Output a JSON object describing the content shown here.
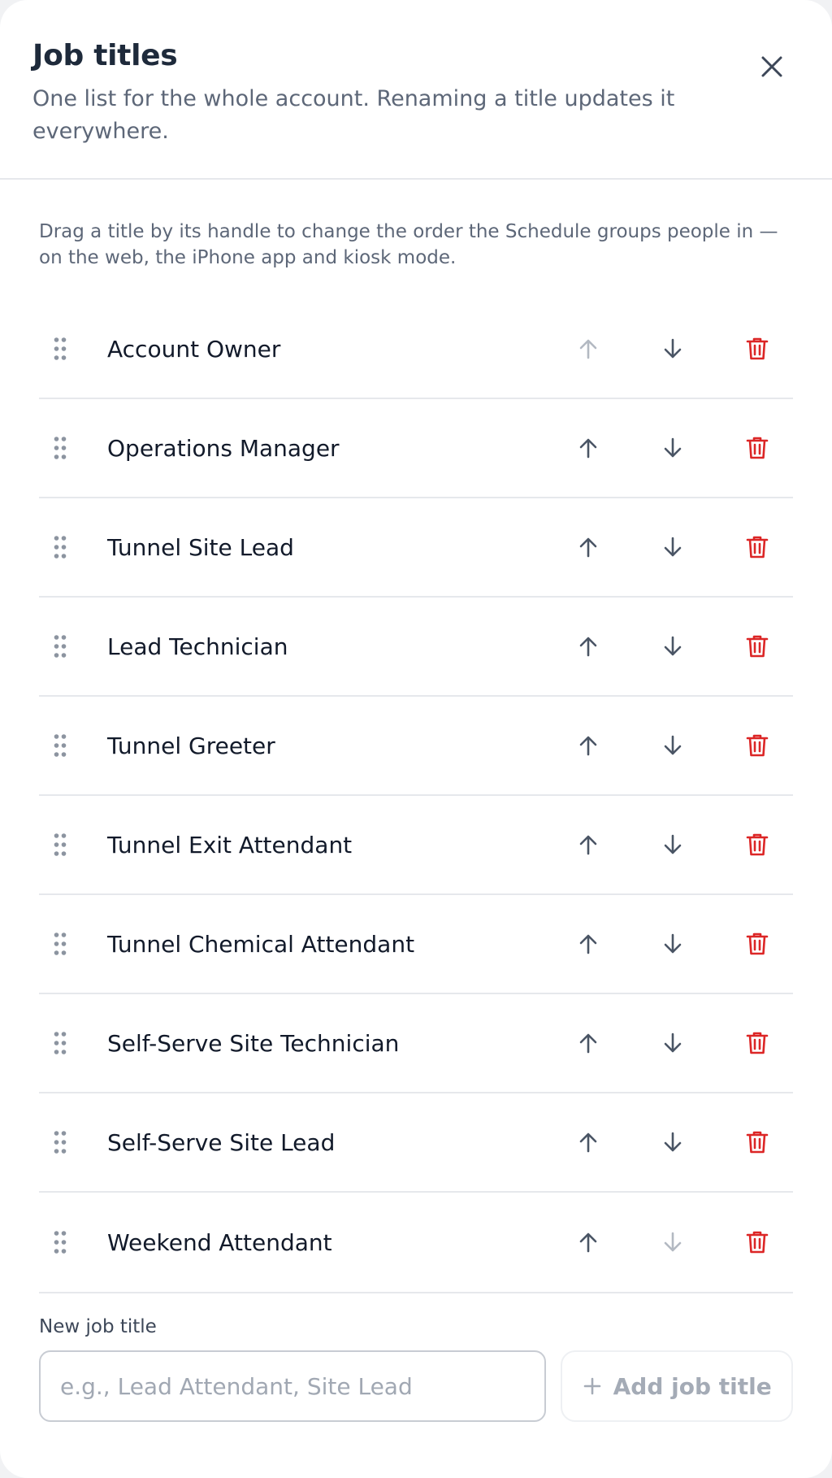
{
  "header": {
    "title": "Job titles",
    "subtitle": "One list for the whole account. Renaming a title updates it everywhere.",
    "close_icon": "close-icon"
  },
  "hint": "Drag a title by its handle to change the order the Schedule groups people in — on the web, the iPhone app and kiosk mode.",
  "job_titles": [
    {
      "label": "Account Owner",
      "up_disabled": true,
      "down_disabled": false
    },
    {
      "label": "Operations Manager",
      "up_disabled": false,
      "down_disabled": false
    },
    {
      "label": "Tunnel Site Lead",
      "up_disabled": false,
      "down_disabled": false
    },
    {
      "label": "Lead Technician",
      "up_disabled": false,
      "down_disabled": false
    },
    {
      "label": "Tunnel Greeter",
      "up_disabled": false,
      "down_disabled": false
    },
    {
      "label": "Tunnel Exit Attendant",
      "up_disabled": false,
      "down_disabled": false
    },
    {
      "label": "Tunnel Chemical Attendant",
      "up_disabled": false,
      "down_disabled": false
    },
    {
      "label": "Self-Serve Site Technician",
      "up_disabled": false,
      "down_disabled": false
    },
    {
      "label": "Self-Serve Site Lead",
      "up_disabled": false,
      "down_disabled": false
    },
    {
      "label": "Weekend Attendant",
      "up_disabled": false,
      "down_disabled": true
    }
  ],
  "new_title": {
    "label": "New job title",
    "value": "",
    "placeholder": "e.g., Lead Attendant, Site Lead",
    "add_button_label": "Add job title",
    "add_button_disabled": true
  },
  "colors": {
    "title": "#1e2a3b",
    "muted_text": "#5d6778",
    "icon": "#4a5565",
    "icon_disabled": "#b3b9c2",
    "danger": "#dc2626",
    "divider": "#e6e8ec"
  },
  "icons": {
    "drag": "drag-handle-icon",
    "up": "arrow-up-icon",
    "down": "arrow-down-icon",
    "delete": "trash-icon",
    "add": "plus-icon"
  }
}
